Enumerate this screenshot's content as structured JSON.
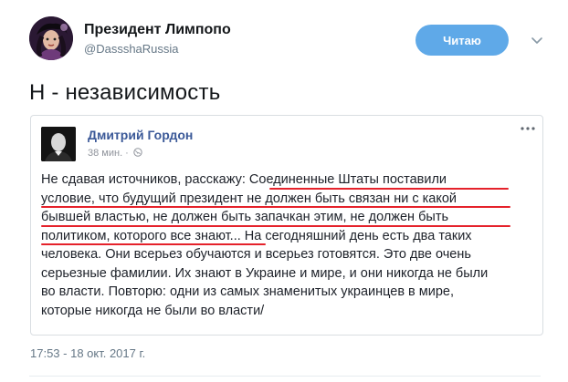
{
  "tweet": {
    "author_name": "Президент Лимпопо",
    "author_handle": "@DassshaRussia",
    "follow_label": "Читаю",
    "text": "Н - независимость",
    "timestamp": "17:53 - 18 окт. 2017 г."
  },
  "quoted_post": {
    "author_name": "Дмитрий Гордон",
    "time_label": "38 мин. ·",
    "lines": [
      "Не сдавая источников, расскажу: Соединенные Штаты поставили",
      "условие, что будущий президент не должен быть связан ни с какой",
      "бывшей властью, не должен быть запачкан этим, не должен быть",
      "политиком, которого все знают... На сегодняшний день есть два таких",
      "человека. Они всерьез обучаются и всерьез готовятся. Это две очень",
      "серьезные фамилии. Их знают в Украине и мире, и они никогда не были",
      "во власти. Повторю: одни из самых знаменитых украинцев в мире,",
      "которые никогда не были во власти/"
    ]
  },
  "colors": {
    "follow_button": "#5fa9e8",
    "fb_name": "#3b5998",
    "underline": "#e5222b",
    "muted": "#657786"
  },
  "icons": {
    "chevron": "chevron-down-icon",
    "globe": "globe-icon",
    "more": "more-options-icon"
  }
}
